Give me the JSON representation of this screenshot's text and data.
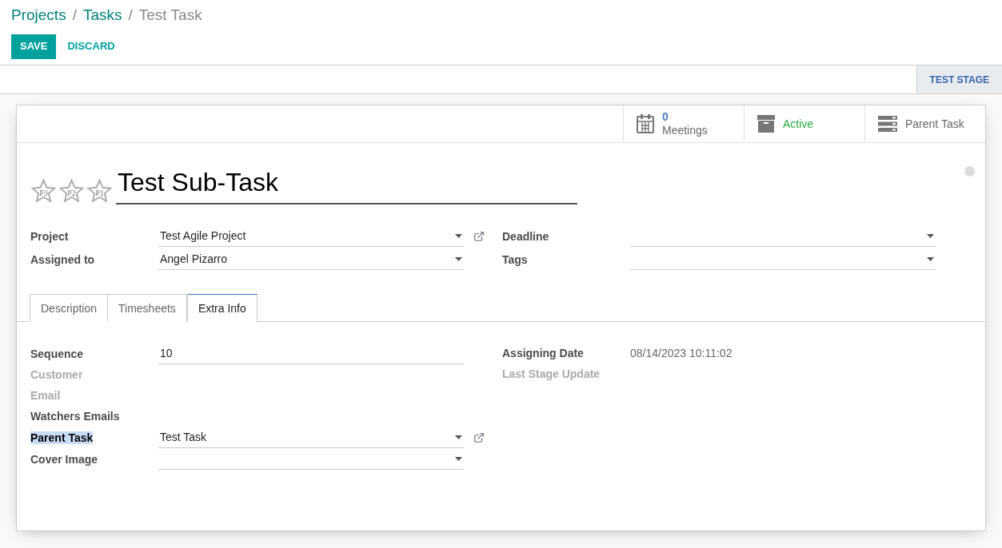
{
  "breadcrumbs": [
    {
      "label": "Projects",
      "current": false
    },
    {
      "label": "Tasks",
      "current": false,
      "separator": "/"
    },
    {
      "label": "Test Task",
      "current": true,
      "separator": "/"
    }
  ],
  "buttons": [
    {
      "label": "SAVE",
      "primary": true
    },
    {
      "label": "DISCARD",
      "primary": false
    }
  ],
  "status_bar": {
    "stages": [
      {
        "label": "TEST STAGE",
        "selected": true
      }
    ]
  },
  "stat_buttons": [
    {
      "kind": "count",
      "value": "0",
      "label": "Meetings"
    },
    {
      "kind": "toggle",
      "label": "Active",
      "on": true
    },
    {
      "kind": "plain",
      "label": "Parent Task"
    }
  ],
  "priority": [
    {
      "label": "P3",
      "checked": false
    },
    {
      "label": "P2",
      "checked": false
    },
    {
      "label": "P1",
      "checked": false
    }
  ],
  "title": "Test Sub-Task",
  "left_fields": [
    {
      "label": "Project",
      "kind": "select",
      "value": "Test Agile Project",
      "link": true,
      "muted": false,
      "highlighted": false
    },
    {
      "label": "Assigned to",
      "kind": "select",
      "value": "Angel Pizarro",
      "link": false,
      "muted": false,
      "highlighted": false
    }
  ],
  "right_fields": [
    {
      "label": "Deadline",
      "kind": "select",
      "link": false,
      "muted": false,
      "highlighted": false
    },
    {
      "label": "Tags",
      "kind": "select",
      "link": false,
      "muted": false,
      "highlighted": false
    }
  ],
  "tabs": [
    {
      "label": "Description",
      "selected": false
    },
    {
      "label": "Timesheets",
      "selected": false
    },
    {
      "label": "Extra Info",
      "selected": true
    }
  ],
  "extra_left": [
    {
      "label": "Sequence",
      "kind": "input",
      "value": "10",
      "link": false,
      "muted": false,
      "highlighted": false
    },
    {
      "label": "Customer",
      "kind": "empty",
      "link": false,
      "muted": true,
      "highlighted": false
    },
    {
      "label": "Email",
      "kind": "empty",
      "link": false,
      "muted": true,
      "highlighted": false
    },
    {
      "label": "Watchers Emails",
      "kind": "empty",
      "link": false,
      "muted": false,
      "highlighted": false
    },
    {
      "label": "Parent Task",
      "kind": "select",
      "value": "Test Task",
      "link": true,
      "muted": false,
      "highlighted": true
    },
    {
      "label": "Cover Image",
      "kind": "select",
      "link": false,
      "muted": false,
      "highlighted": false
    }
  ],
  "extra_right": [
    {
      "label": "Assigning Date",
      "kind": "text",
      "value": "08/14/2023 10:11:02",
      "link": false,
      "muted": false,
      "highlighted": false
    },
    {
      "label": "Last Stage Update",
      "kind": "empty",
      "link": false,
      "muted": true,
      "highlighted": false
    }
  ]
}
